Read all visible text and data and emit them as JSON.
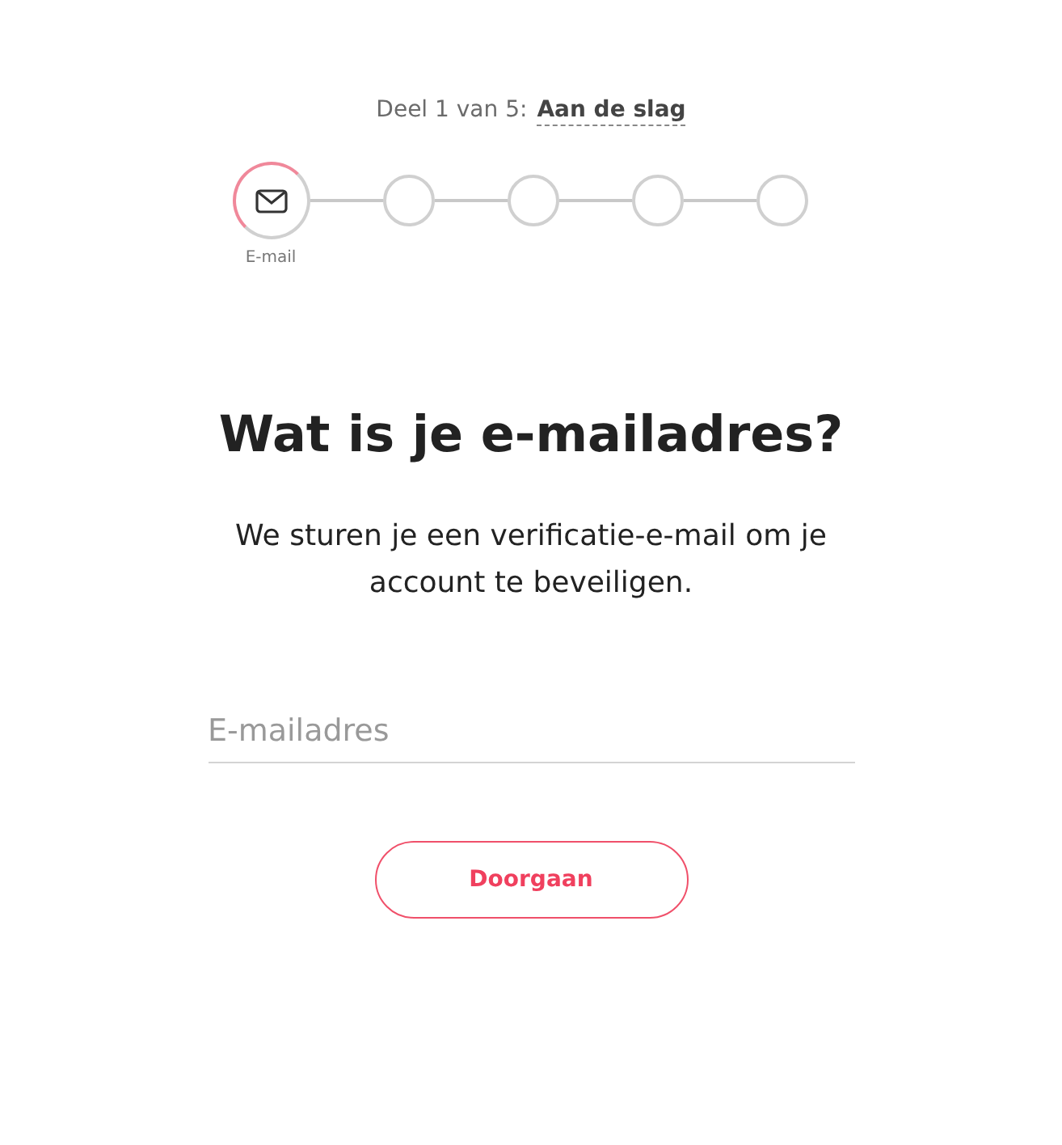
{
  "progress": {
    "prefix": "Deel 1 van 5:",
    "section": "Aan de slag"
  },
  "steps": [
    {
      "label": "E-mail",
      "selected": true
    },
    {
      "selected": false
    },
    {
      "selected": false
    },
    {
      "selected": false
    },
    {
      "selected": false
    }
  ],
  "heading": "Wat is je e-mailadres?",
  "description": "We sturen je een verificatie-e-mail om je account te beveiligen.",
  "email_field": {
    "placeholder": "E-mailadres"
  },
  "continue_button": "Doorgaan"
}
